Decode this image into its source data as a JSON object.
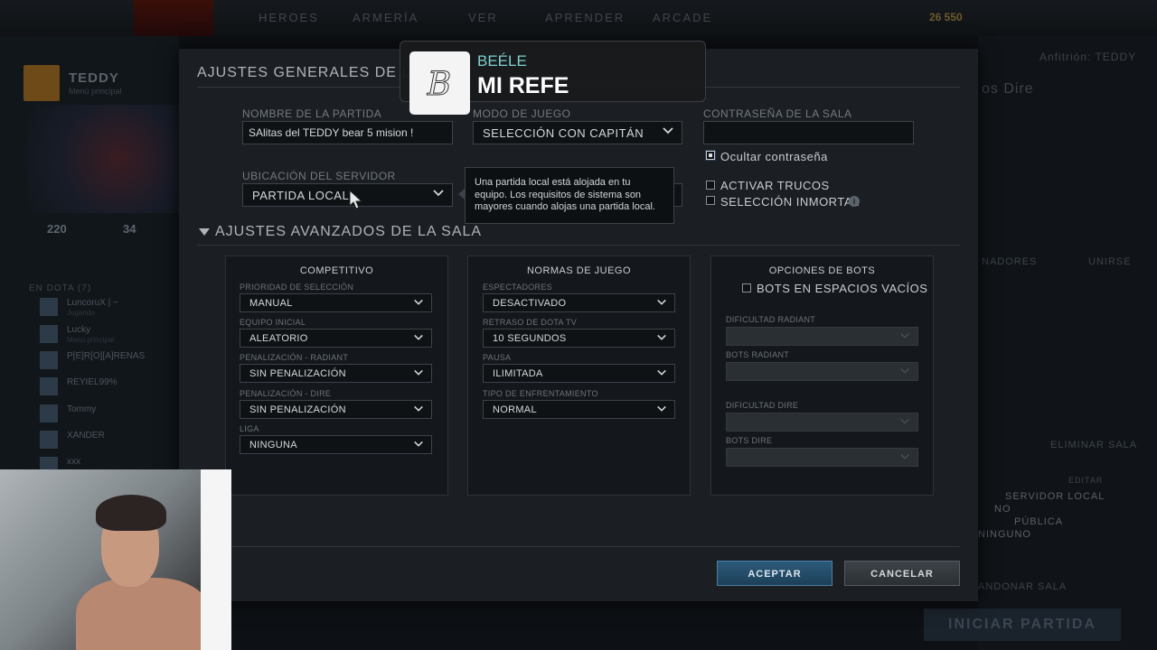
{
  "topbar": {
    "nav": [
      "HEROES",
      "ARMERÍA",
      "VER",
      "APRENDER",
      "ARCADE"
    ],
    "coins": "26 550"
  },
  "left_panel": {
    "player_name": "TEDDY",
    "player_status": "Menú principal",
    "stat1_value": "220",
    "stat2_value": "34",
    "friends_header": "EN DOTA (7)",
    "friends": [
      {
        "name": "LuncoruX | ~",
        "status": "Jugando"
      },
      {
        "name": "Lucky",
        "status": "Menú principal"
      },
      {
        "name": "P[E]R[O][A]RENAS",
        "status": ""
      },
      {
        "name": "REYIEL99%",
        "status": ""
      },
      {
        "name": "Tommy",
        "status": ""
      },
      {
        "name": "XANDER",
        "status": ""
      },
      {
        "name": "xxx",
        "status": ""
      }
    ]
  },
  "right_panel": {
    "host": "Anfitrión: TEDDY",
    "team": "os Dire",
    "coaches": "NADORES",
    "join": "UNIRSE",
    "delete": "ELIMINAR SALA",
    "edit": "EDITAR",
    "server": "SERVIDOR LOCAL",
    "no": "NO",
    "public": "PÚBLICA",
    "none": "NINGUNO",
    "abandon": "ANDONAR SALA",
    "start": "INICIAR PARTIDA"
  },
  "dialog": {
    "title": "AJUSTES GENERALES DE LA SALA",
    "game_name_label": "NOMBRE DE LA PARTIDA",
    "game_name_value": "SAlitas del TEDDY  bear 5 mision !",
    "game_mode_label": "MODO DE JUEGO",
    "game_mode_value": "SELECCIÓN CON CAPITÁN",
    "password_label": "CONTRASEÑA DE LA SALA",
    "password_value": "",
    "hide_password_label": "Ocultar contraseña",
    "server_location_label": "UBICACIÓN DEL SERVIDOR",
    "server_location_value": "PARTIDA LOCAL",
    "tooltip_text": "Una partida local está alojada en tu equipo. Los requisitos de sistema son mayores cuando alojas una partida local.",
    "cheats_label": "ACTIVAR TRUCOS",
    "immortal_label": "SELECCIÓN INMORTAL",
    "info_icon_glyph": "i",
    "advanced_title": "AJUSTES AVANZADOS DE LA SALA",
    "competitive": {
      "title": "COMPETITIVO",
      "fields": [
        {
          "label": "PRIORIDAD DE SELECCIÓN",
          "value": "MANUAL"
        },
        {
          "label": "EQUIPO INICIAL",
          "value": "ALEATORIO"
        },
        {
          "label": "PENALIZACIÓN - RADIANT",
          "value": "SIN PENALIZACIÓN"
        },
        {
          "label": "PENALIZACIÓN - DIRE",
          "value": "SIN PENALIZACIÓN"
        },
        {
          "label": "LIGA",
          "value": "NINGUNA"
        }
      ]
    },
    "rules": {
      "title": "NORMAS DE JUEGO",
      "fields": [
        {
          "label": "ESPECTADORES",
          "value": "DESACTIVADO"
        },
        {
          "label": "RETRASO DE DOTA TV",
          "value": "10 SEGUNDOS"
        },
        {
          "label": "PAUSA",
          "value": "ILIMITADA"
        },
        {
          "label": "TIPO DE ENFRENTAMIENTO",
          "value": "NORMAL"
        }
      ]
    },
    "bots": {
      "title": "OPCIONES DE BOTS",
      "fill_label": "BOTS EN ESPACIOS VACÍOS",
      "fields": [
        {
          "label": "DIFICULTAD RADIANT",
          "value": ""
        },
        {
          "label": "BOTS RADIANT",
          "value": ""
        },
        {
          "label": "DIFICULTAD DIRE",
          "value": ""
        },
        {
          "label": "BOTS DIRE",
          "value": ""
        }
      ]
    },
    "accept_label": "ACEPTAR",
    "cancel_label": "CANCELAR"
  },
  "notification": {
    "artist": "BEÉLE",
    "song": "MI REFE"
  },
  "colors": {
    "accent_blue": "#2c5a7a",
    "notification_artist": "#7fd0cf"
  },
  "icons": {
    "chevron": "chevron-down-icon",
    "info": "info-icon",
    "triangle": "collapse-triangle-icon"
  }
}
